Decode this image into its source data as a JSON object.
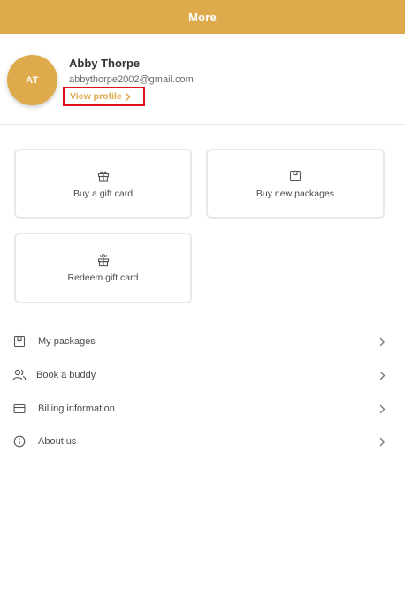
{
  "header": {
    "title": "More"
  },
  "profile": {
    "initials": "AT",
    "name": "Abby Thorpe",
    "email": "abbythorpe2002@gmail.com",
    "view_profile_label": "View profile"
  },
  "cards": [
    {
      "label": "Buy a gift card",
      "icon": "gift-icon"
    },
    {
      "label": "Buy new packages",
      "icon": "package-icon"
    },
    {
      "label": "Redeem gift card",
      "icon": "redeem-gift-icon"
    }
  ],
  "menu": [
    {
      "label": "My packages",
      "icon": "package-icon"
    },
    {
      "label": "Book a buddy",
      "icon": "users-icon"
    },
    {
      "label": "Billing information",
      "icon": "credit-card-icon"
    },
    {
      "label": "About us",
      "icon": "info-icon"
    }
  ],
  "colors": {
    "accent": "#dfaa4b",
    "highlight_border": "#e0101c"
  }
}
